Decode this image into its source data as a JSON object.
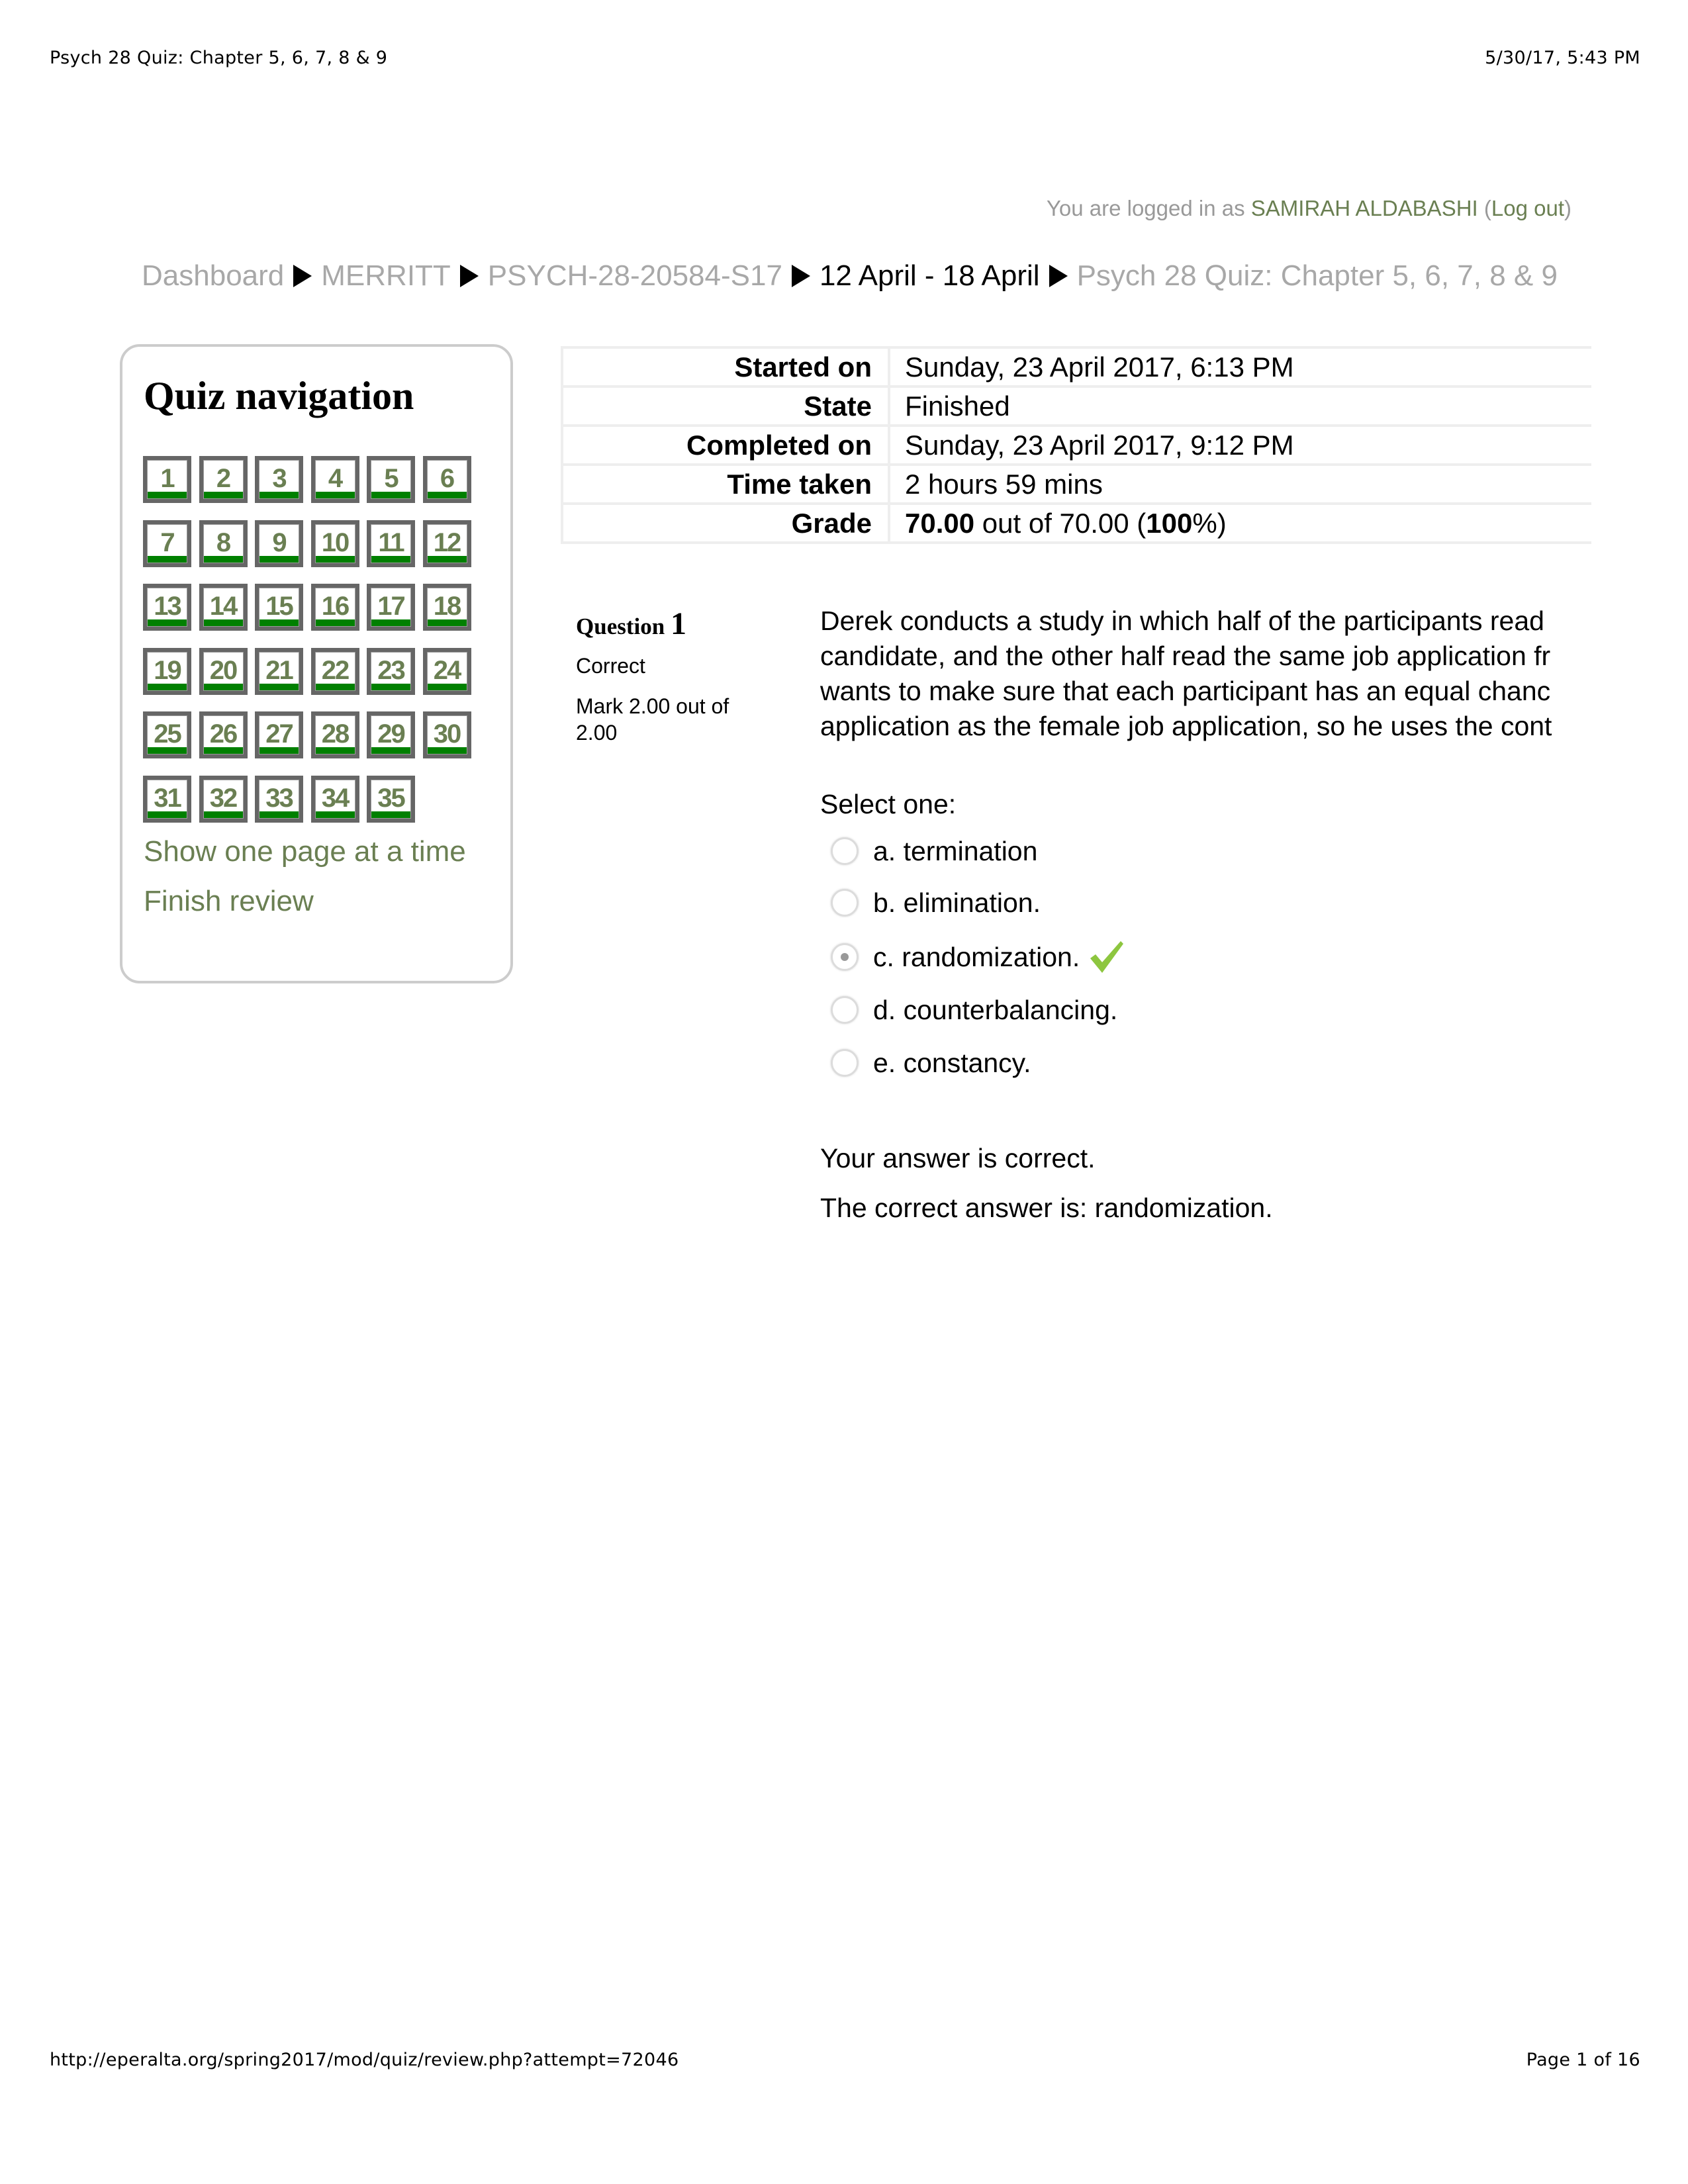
{
  "print_header": {
    "title": "Psych 28 Quiz: Chapter 5, 6, 7, 8 & 9",
    "datetime": "5/30/17, 5:43 PM"
  },
  "login": {
    "prefix": "You are logged in as ",
    "user": "SAMIRAH ALDABASHI",
    "open_paren": " (",
    "logout": "Log out",
    "close_paren": ")"
  },
  "breadcrumb": [
    {
      "label": "Dashboard",
      "type": "link"
    },
    {
      "label": "MERRITT",
      "type": "link"
    },
    {
      "label": "PSYCH-28-20584-S17",
      "type": "link"
    },
    {
      "label": "12 April - 18 April",
      "type": "current"
    },
    {
      "label": "Psych 28 Quiz: Chapter 5, 6, 7, 8 & 9",
      "type": "link"
    }
  ],
  "quiz_nav": {
    "title": "Quiz navigation",
    "questions": [
      "1",
      "2",
      "3",
      "4",
      "5",
      "6",
      "7",
      "8",
      "9",
      "10",
      "11",
      "12",
      "13",
      "14",
      "15",
      "16",
      "17",
      "18",
      "19",
      "20",
      "21",
      "22",
      "23",
      "24",
      "25",
      "26",
      "27",
      "28",
      "29",
      "30",
      "31",
      "32",
      "33",
      "34",
      "35"
    ],
    "status": "correct",
    "links": {
      "show_one_page": "Show one page at a time",
      "finish_review": "Finish review"
    }
  },
  "summary": [
    {
      "label": "Started on",
      "value": "Sunday, 23 April 2017, 6:13 PM"
    },
    {
      "label": "State",
      "value": "Finished"
    },
    {
      "label": "Completed on",
      "value": "Sunday, 23 April 2017, 9:12 PM"
    },
    {
      "label": "Time taken",
      "value": "2 hours 59 mins"
    },
    {
      "label": "Grade",
      "value_bold": "70.00",
      "value_mid": " out of 70.00 (",
      "value_pct": "100",
      "value_end": "%)"
    }
  ],
  "question": {
    "label": "Question ",
    "number": "1",
    "state": "Correct",
    "mark": "Mark 2.00 out of 2.00",
    "text_lines": [
      "Derek conducts a study in which half of the participants read",
      "candidate, and the other half read the same job application fr",
      "wants to make sure that each participant has an equal chanc",
      "application as the female job application, so he uses the cont"
    ],
    "select_prompt": "Select one:",
    "options": [
      {
        "label": "a. termination",
        "checked": false
      },
      {
        "label": "b. elimination.",
        "checked": false
      },
      {
        "label": "c. randomization.",
        "checked": true,
        "correct": true
      },
      {
        "label": "d. counterbalancing.",
        "checked": false
      },
      {
        "label": "e. constancy.",
        "checked": false
      }
    ],
    "feedback": "Your answer is correct.",
    "right_answer": "The correct answer is: randomization."
  },
  "print_footer": {
    "url": "http://eperalta.org/spring2017/mod/quiz/review.php?attempt=72046",
    "page": "Page 1 of 16"
  },
  "colors": {
    "link_green": "#6a7f52",
    "nav_bar_green": "#008000",
    "check_green": "#8dc63f",
    "breadcrumb_grey": "#a8a8a8"
  }
}
